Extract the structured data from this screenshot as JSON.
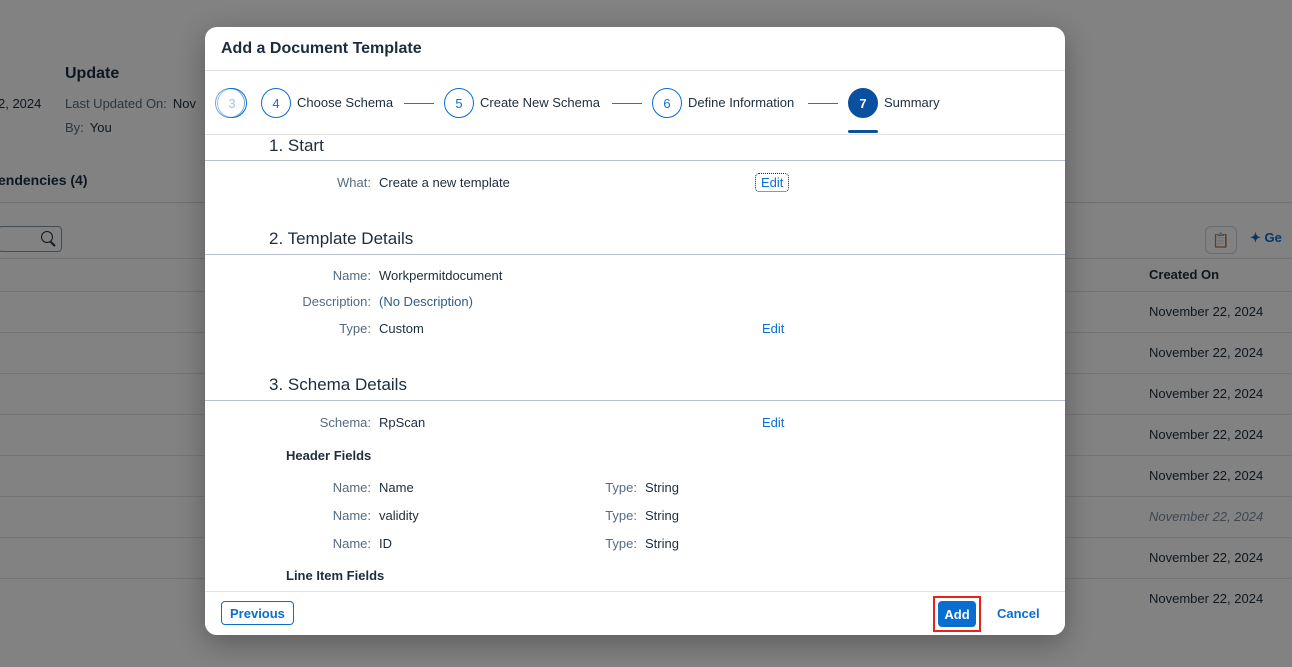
{
  "background": {
    "update_title": "Update",
    "date_left": "2, 2024",
    "last_updated_label": "Last Updated On:",
    "last_updated_value": "Nov",
    "by_label": "By:",
    "by_value": "You",
    "dependencies_tab": "endencies (4)",
    "generate_label": "Ge",
    "created_on_header": "Created On",
    "rows": [
      "November 22, 2024",
      "November 22, 2024",
      "November 22, 2024",
      "November 22, 2024",
      "November 22, 2024",
      "November 22, 2024",
      "November 22, 2024",
      "November 22, 2024"
    ]
  },
  "dialog": {
    "title": "Add a Document Template",
    "steps": [
      {
        "number": "3",
        "label": ""
      },
      {
        "number": "4",
        "label": "Choose Schema"
      },
      {
        "number": "5",
        "label": "Create New Schema"
      },
      {
        "number": "6",
        "label": "Define Information"
      },
      {
        "number": "7",
        "label": "Summary"
      }
    ],
    "active_step": "7",
    "sections": {
      "start": {
        "title": "1. Start",
        "what_label": "What:",
        "what_value": "Create a new template",
        "edit_label": "Edit"
      },
      "template_details": {
        "title": "2. Template Details",
        "name_label": "Name:",
        "name_value": "Workpermitdocument",
        "description_label": "Description:",
        "description_value": "(No Description)",
        "type_label": "Type:",
        "type_value": "Custom",
        "edit_label": "Edit"
      },
      "schema_details": {
        "title": "3. Schema Details",
        "schema_label": "Schema:",
        "schema_value": "RpScan",
        "edit_label": "Edit",
        "header_fields_title": "Header Fields",
        "header_fields": [
          {
            "name_label": "Name:",
            "name": "Name",
            "type_label": "Type:",
            "type": "String"
          },
          {
            "name_label": "Name:",
            "name": "validity",
            "type_label": "Type:",
            "type": "String"
          },
          {
            "name_label": "Name:",
            "name": "ID",
            "type_label": "Type:",
            "type": "String"
          }
        ],
        "line_item_fields_title": "Line Item Fields"
      }
    },
    "footer": {
      "previous_label": "Previous",
      "add_label": "Add",
      "cancel_label": "Cancel"
    }
  },
  "colors": {
    "accent": "#0a6ed1",
    "active_step": "#0a4fa0",
    "highlight": "#e8221b"
  }
}
